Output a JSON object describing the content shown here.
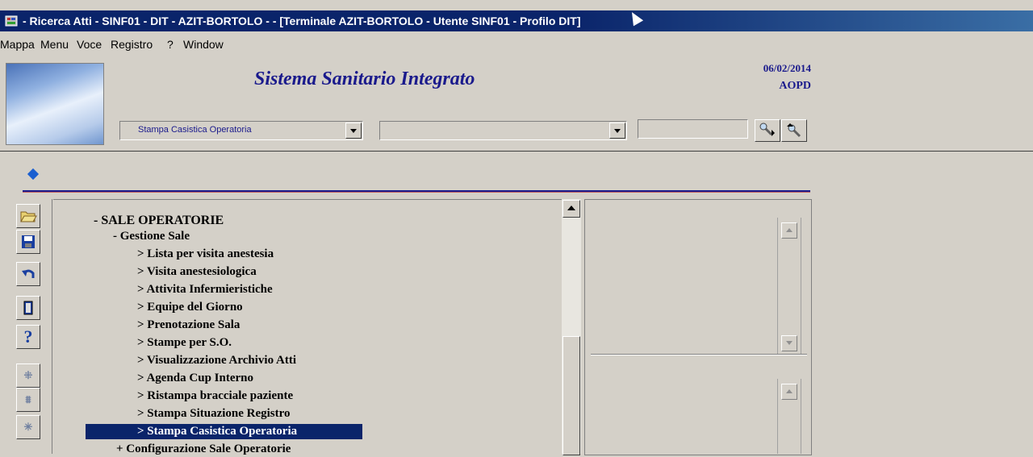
{
  "window": {
    "title": "- Ricerca Atti - SINF01 - DIT - AZIT-BORTOLO - - [Terminale AZIT-BORTOLO - Utente SINF01 - Profilo DIT]",
    "app_icon": "form-icon"
  },
  "menu": [
    "Mappa",
    "Menu",
    "Voce",
    "Registro",
    "?",
    "Window"
  ],
  "header": {
    "app_title": "Sistema Sanitario Integrato",
    "date": "06/02/2014",
    "site": "AOPD",
    "combo1_value": "Stampa Casistica Operatoria",
    "combo2_value": "",
    "text_value": ""
  },
  "toolbar": {
    "icons": [
      "open-folder-icon",
      "save-icon",
      "undo-icon",
      "exit-door-icon",
      "help-icon",
      "expand-tree-icon",
      "collapse-tree-icon",
      "expand-branch-icon"
    ]
  },
  "tree": {
    "items": [
      {
        "label": "- SALE OPERATORIE",
        "level": 0
      },
      {
        "label": "- Gestione Sale",
        "level": 1
      },
      {
        "label": "> Lista per visita anestesia",
        "level": 2
      },
      {
        "label": "> Visita anestesiologica",
        "level": 2
      },
      {
        "label": "> Attivita Infermieristiche",
        "level": 2
      },
      {
        "label": "> Equipe del Giorno",
        "level": 2
      },
      {
        "label": "> Prenotazione Sala",
        "level": 2
      },
      {
        "label": "> Stampe per S.O.",
        "level": 2
      },
      {
        "label": "> Visualizzazione Archivio Atti",
        "level": 2
      },
      {
        "label": "> Agenda Cup Interno",
        "level": 2
      },
      {
        "label": "> Ristampa bracciale paziente",
        "level": 2
      },
      {
        "label": "> Stampa Situazione Registro",
        "level": 2
      },
      {
        "label": "> Stampa Casistica Operatoria",
        "level": 2,
        "selected": true
      },
      {
        "label": "+ Configurazione Sale Operatorie",
        "level": 1
      }
    ]
  },
  "colors": {
    "titlebar": "#0a246a",
    "accent_text": "#1a1a8c",
    "selection": "#0a246a",
    "background": "#d4d0c8"
  }
}
